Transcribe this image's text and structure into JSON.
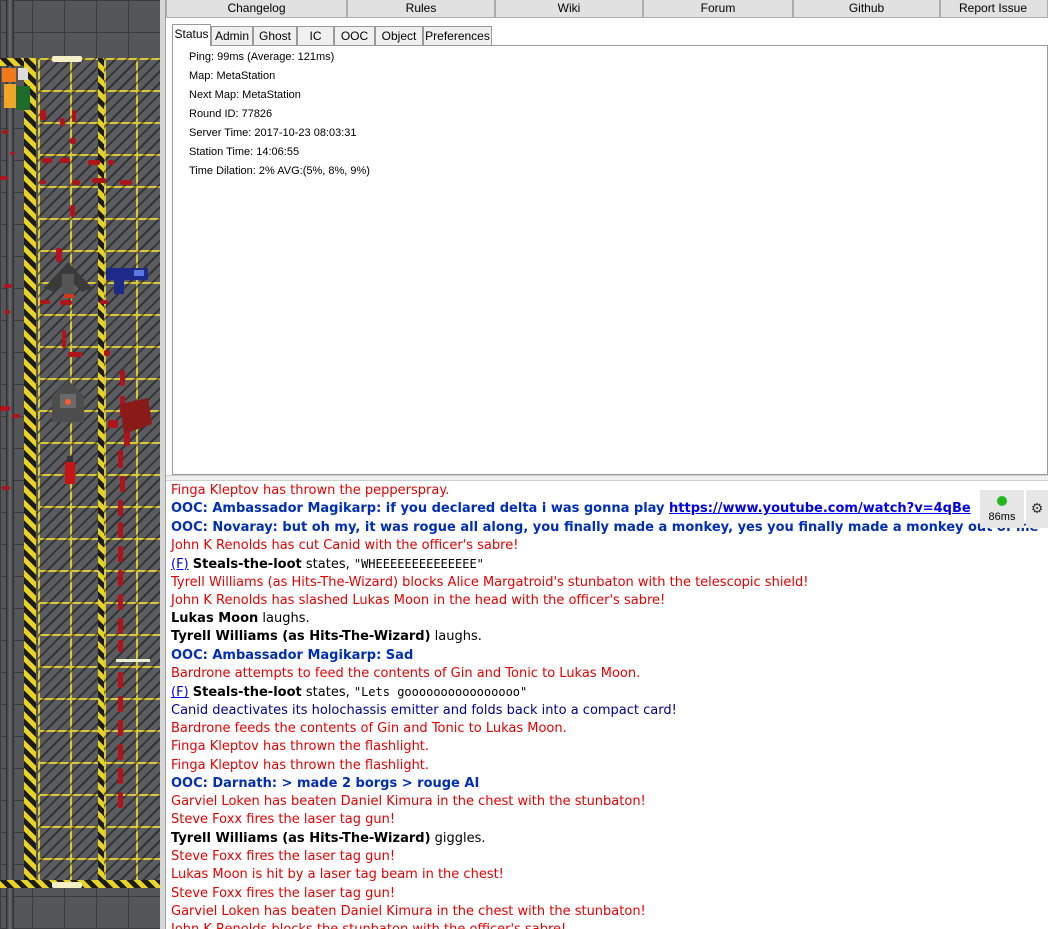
{
  "linkbar": {
    "buttons": [
      "Changelog",
      "Rules",
      "Wiki",
      "Forum",
      "Github",
      "Report Issue"
    ]
  },
  "tabs": [
    "Status",
    "Admin",
    "Ghost",
    "IC",
    "OOC",
    "Object",
    "Preferences"
  ],
  "active_tab": "Status",
  "status": {
    "ping": "Ping: 99ms (Average: 121ms)",
    "map": "Map: MetaStation",
    "next_map": "Next Map: MetaStation",
    "round_id": "Round ID: 77826",
    "server_time": "Server Time: 2017-10-23 08:03:31",
    "station_time": "Station Time: 14:06:55",
    "time_dilation": "Time Dilation: 2% AVG:(5%, 8%, 9%)"
  },
  "ping_indicator": {
    "label": "86ms",
    "color": "#22b522"
  },
  "gear_icon": "gear-icon",
  "chat": [
    {
      "style": "red",
      "text": "Finga Kleptov has thrown the pepperspray."
    },
    {
      "style": "ooc",
      "text": "OOC: Ambassador Magikarp: if you declared delta i was gonna play ",
      "link": "https://www.youtube.com/watch?v=4qBe"
    },
    {
      "style": "ooc",
      "text": "OOC: Novaray: but oh my, it was rogue all along, you finally made a monkey, yes you finally made a monkey out of me"
    },
    {
      "style": "red",
      "text": "John K Renolds has cut Canid with the officer's sabre!"
    },
    {
      "style": "say",
      "flink": "(F)",
      "speaker": "Steals-the-loot",
      "verb": " states, ",
      "speech": "\"WHEEEEEEEEEEEEEE\""
    },
    {
      "style": "red",
      "text": "Tyrell Williams (as Hits-The-Wizard) blocks Alice Margatroid's stunbaton with the telescopic shield!"
    },
    {
      "style": "red",
      "text": "John K Renolds has slashed Lukas Moon in the head with the officer's sabre!"
    },
    {
      "style": "emote",
      "speaker": "Lukas Moon",
      "text": " laughs."
    },
    {
      "style": "emote",
      "speaker": "Tyrell Williams (as Hits-The-Wizard)",
      "text": " laughs."
    },
    {
      "style": "ooc",
      "text": "OOC: Ambassador Magikarp: Sad"
    },
    {
      "style": "red",
      "text": "Bardrone attempts to feed the contents of Gin and Tonic to Lukas Moon."
    },
    {
      "style": "say",
      "flink": "(F)",
      "speaker": "Steals-the-loot",
      "verb": " states, ",
      "speech": "\"Lets goooooooooooooooo\""
    },
    {
      "style": "navy",
      "text": "Canid deactivates its holochassis emitter and folds back into a compact card!"
    },
    {
      "style": "red",
      "text": "Bardrone feeds the contents of Gin and Tonic to Lukas Moon."
    },
    {
      "style": "red",
      "text": "Finga Kleptov has thrown the flashlight."
    },
    {
      "style": "red",
      "text": "Finga Kleptov has thrown the flashlight."
    },
    {
      "style": "ooc",
      "text": "OOC: Darnath: > made 2 borgs > rouge AI"
    },
    {
      "style": "red",
      "text": "Garviel Loken has beaten Daniel Kimura in the chest with the stunbaton!"
    },
    {
      "style": "red",
      "text": "Steve Foxx fires the laser tag gun!"
    },
    {
      "style": "emote",
      "speaker": "Tyrell Williams (as Hits-The-Wizard)",
      "text": " giggles."
    },
    {
      "style": "red",
      "text": "Steve Foxx fires the laser tag gun!"
    },
    {
      "style": "red",
      "text": "Lukas Moon is hit by a laser tag beam in the chest!"
    },
    {
      "style": "red",
      "text": "Steve Foxx fires the laser tag gun!"
    },
    {
      "style": "red",
      "text": "Garviel Loken has beaten Daniel Kimura in the chest with the stunbaton!"
    },
    {
      "style": "red",
      "text": "John K Renolds blocks the stunbaton with the officer's sabre!"
    }
  ]
}
